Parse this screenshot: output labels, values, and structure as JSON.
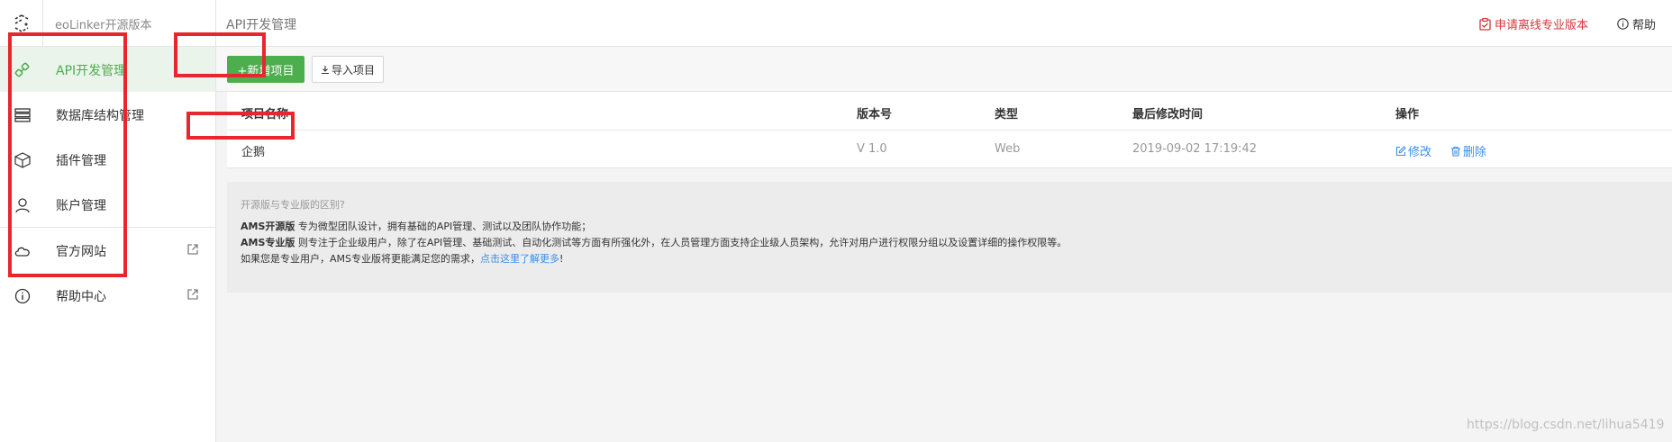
{
  "header": {
    "app_name": "eoLinker开源版本",
    "page_title": "API开发管理",
    "apply_label": "申请离线专业版本",
    "help_label": "帮助",
    "accent_color": "#d6353b"
  },
  "sidebar": {
    "items": [
      {
        "label": "API开发管理",
        "icon": "link-icon",
        "active": true
      },
      {
        "label": "数据库结构管理",
        "icon": "database-icon",
        "active": false
      },
      {
        "label": "插件管理",
        "icon": "cube-icon",
        "active": false
      },
      {
        "label": "账户管理",
        "icon": "user-icon",
        "active": false
      },
      {
        "label": "官方网站",
        "icon": "cloud-icon",
        "external": true
      },
      {
        "label": "帮助中心",
        "icon": "info-icon",
        "external": true
      }
    ]
  },
  "toolbar": {
    "add_label": "+新增项目",
    "import_label": "导入项目",
    "brand_color": "#4cae4c"
  },
  "table": {
    "columns": [
      "项目名称",
      "版本号",
      "类型",
      "最后修改时间",
      "操作"
    ],
    "rows": [
      {
        "name": "企鹅",
        "version": "V 1.0",
        "type": "Web",
        "modified": "2019-09-02 17:19:42",
        "edit_label": "修改",
        "delete_label": "删除"
      }
    ]
  },
  "info": {
    "title": "开源版与专业版的区别?",
    "line1_bold": "AMS开源版",
    "line1_text": " 专为微型团队设计，拥有基础的API管理、测试以及团队协作功能；",
    "line2_bold": "AMS专业版",
    "line2_text": " 则专注于企业级用户，除了在API管理、基础测试、自动化测试等方面有所强化外，在人员管理方面支持企业级人员架构，允许对用户进行权限分组以及设置详细的操作权限等。",
    "line3_text": "如果您是专业用户，AMS专业版将更能满足您的需求，",
    "line3_link": "点击这里了解更多",
    "line3_tail": "!"
  },
  "watermark": "https://blog.csdn.net/lihua5419"
}
